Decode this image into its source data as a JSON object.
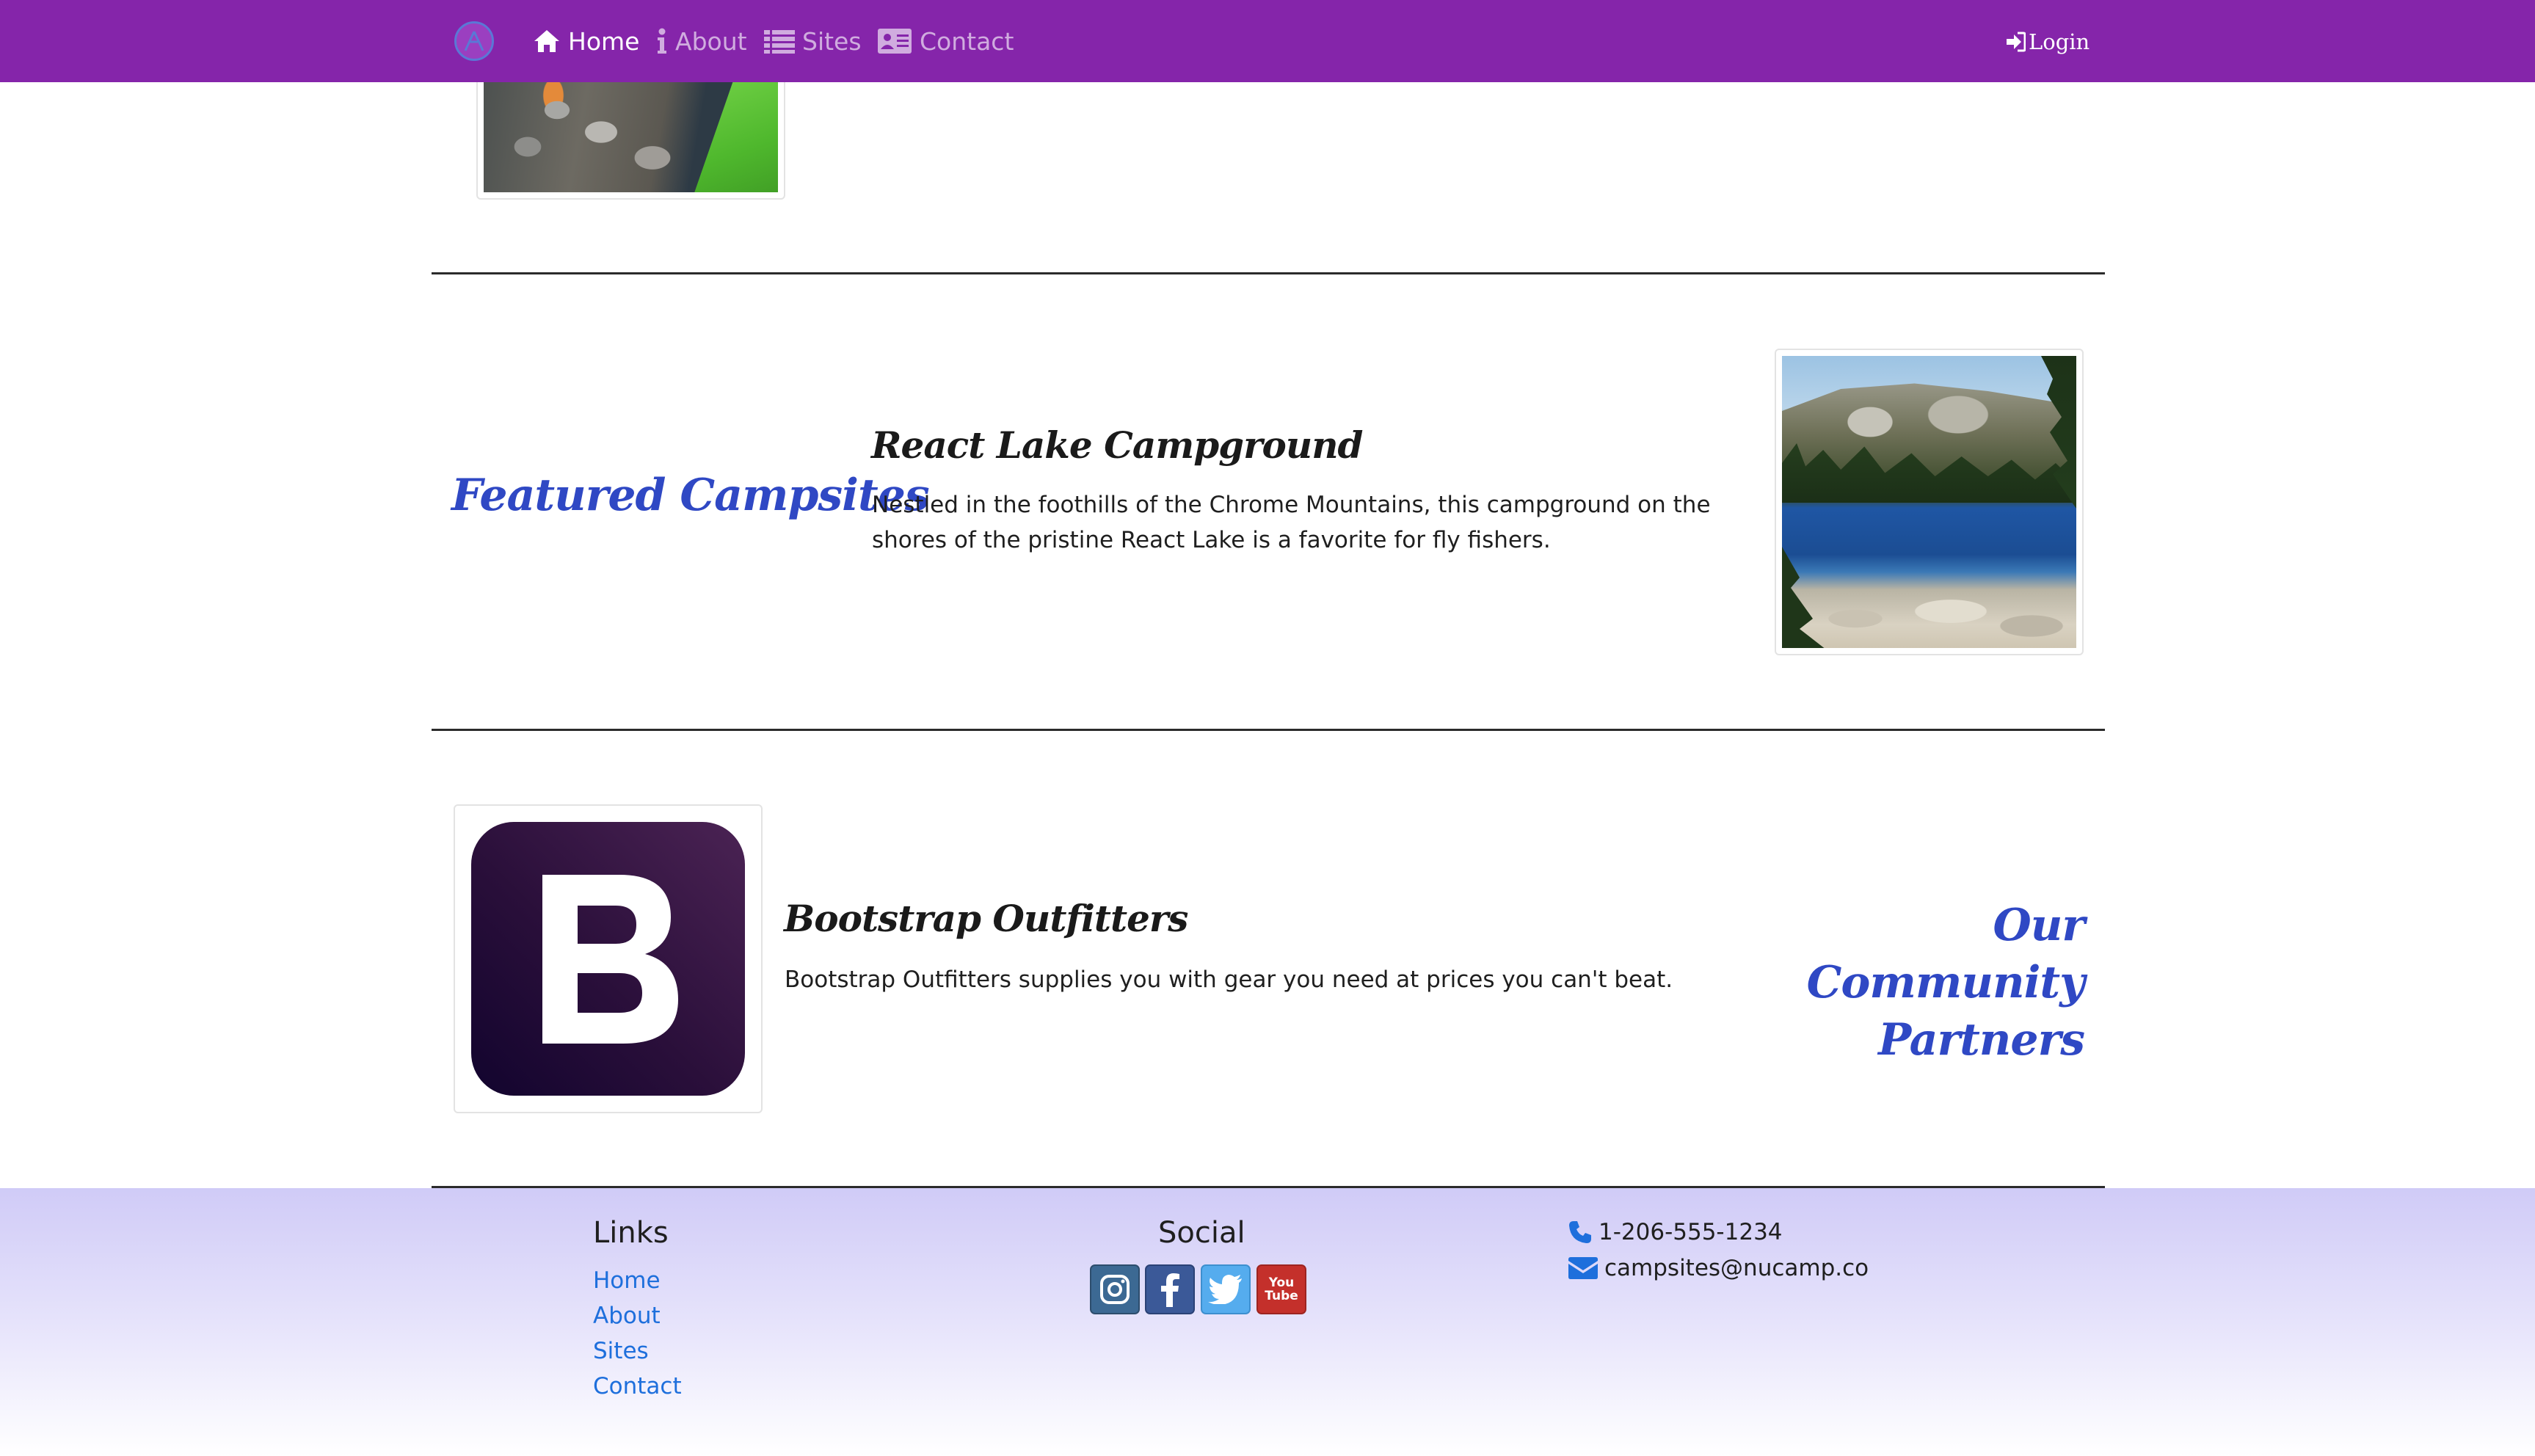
{
  "navbar": {
    "items": [
      {
        "label": "Home",
        "icon": "home-icon",
        "active": true
      },
      {
        "label": "About",
        "icon": "info-icon",
        "active": false
      },
      {
        "label": "Sites",
        "icon": "list-icon",
        "active": false
      },
      {
        "label": "Contact",
        "icon": "address-card-icon",
        "active": false
      }
    ],
    "login_label": "Login",
    "background": "#8525aa"
  },
  "featured": {
    "heading": "Featured Campsites",
    "title": "React Lake Campground",
    "text": "Nestled in the foothills of the Chrome Mountains, this campground on the shores of the pristine React Lake is a favorite for fly fishers."
  },
  "partners": {
    "heading_line1": "Our Community",
    "heading_line2": "Partners",
    "title": "Bootstrap Outfitters",
    "text": "Bootstrap Outfitters supplies you with gear you need at prices you can't beat.",
    "logo_letter": "B"
  },
  "footer": {
    "links_heading": "Links",
    "links": [
      "Home",
      "About",
      "Sites",
      "Contact"
    ],
    "social_heading": "Social",
    "social": [
      {
        "name": "instagram",
        "icon": "instagram-icon"
      },
      {
        "name": "facebook",
        "icon": "facebook-icon"
      },
      {
        "name": "twitter",
        "icon": "twitter-icon"
      },
      {
        "name": "youtube",
        "icon": "youtube-icon",
        "text_top": "You",
        "text_bottom": "Tube"
      }
    ],
    "phone": "1-206-555-1234",
    "email": "campsites@nucamp.co"
  },
  "colors": {
    "heading_blue": "#2f48c4",
    "link_blue": "#1e6fdc"
  }
}
